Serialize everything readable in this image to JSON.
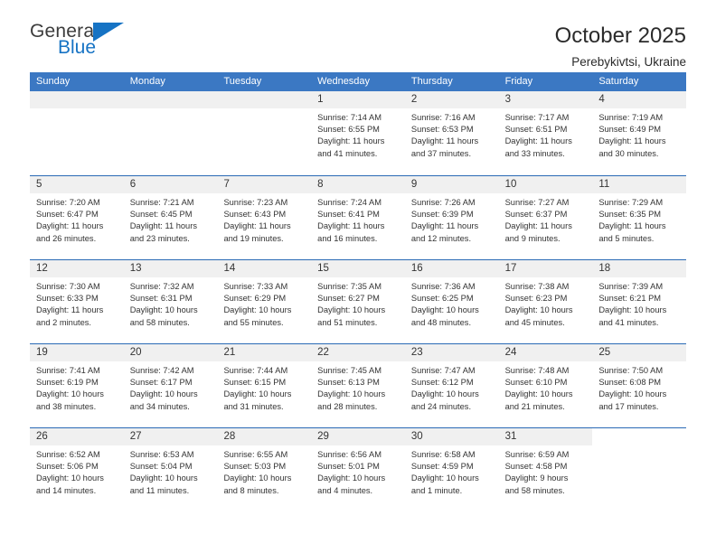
{
  "brand": {
    "name_top": "General",
    "name_bottom": "Blue",
    "accent_color": "#1673c4"
  },
  "header": {
    "title": "October 2025",
    "subtitle": "Perebykivtsi, Ukraine"
  },
  "theme": {
    "header_row_bg": "#3b78c3",
    "week_divider": "#2a6ab5",
    "day_number_bg": "#f0f0f0"
  },
  "calendar": {
    "day_names": [
      "Sunday",
      "Monday",
      "Tuesday",
      "Wednesday",
      "Thursday",
      "Friday",
      "Saturday"
    ],
    "weeks": [
      [
        {
          "day": "",
          "blank": true
        },
        {
          "day": "",
          "blank": true
        },
        {
          "day": "",
          "blank": true
        },
        {
          "day": "1",
          "sunrise": "Sunrise: 7:14 AM",
          "sunset": "Sunset: 6:55 PM",
          "daylight_line1": "Daylight: 11 hours",
          "daylight_line2": "and 41 minutes."
        },
        {
          "day": "2",
          "sunrise": "Sunrise: 7:16 AM",
          "sunset": "Sunset: 6:53 PM",
          "daylight_line1": "Daylight: 11 hours",
          "daylight_line2": "and 37 minutes."
        },
        {
          "day": "3",
          "sunrise": "Sunrise: 7:17 AM",
          "sunset": "Sunset: 6:51 PM",
          "daylight_line1": "Daylight: 11 hours",
          "daylight_line2": "and 33 minutes."
        },
        {
          "day": "4",
          "sunrise": "Sunrise: 7:19 AM",
          "sunset": "Sunset: 6:49 PM",
          "daylight_line1": "Daylight: 11 hours",
          "daylight_line2": "and 30 minutes."
        }
      ],
      [
        {
          "day": "5",
          "sunrise": "Sunrise: 7:20 AM",
          "sunset": "Sunset: 6:47 PM",
          "daylight_line1": "Daylight: 11 hours",
          "daylight_line2": "and 26 minutes."
        },
        {
          "day": "6",
          "sunrise": "Sunrise: 7:21 AM",
          "sunset": "Sunset: 6:45 PM",
          "daylight_line1": "Daylight: 11 hours",
          "daylight_line2": "and 23 minutes."
        },
        {
          "day": "7",
          "sunrise": "Sunrise: 7:23 AM",
          "sunset": "Sunset: 6:43 PM",
          "daylight_line1": "Daylight: 11 hours",
          "daylight_line2": "and 19 minutes."
        },
        {
          "day": "8",
          "sunrise": "Sunrise: 7:24 AM",
          "sunset": "Sunset: 6:41 PM",
          "daylight_line1": "Daylight: 11 hours",
          "daylight_line2": "and 16 minutes."
        },
        {
          "day": "9",
          "sunrise": "Sunrise: 7:26 AM",
          "sunset": "Sunset: 6:39 PM",
          "daylight_line1": "Daylight: 11 hours",
          "daylight_line2": "and 12 minutes."
        },
        {
          "day": "10",
          "sunrise": "Sunrise: 7:27 AM",
          "sunset": "Sunset: 6:37 PM",
          "daylight_line1": "Daylight: 11 hours",
          "daylight_line2": "and 9 minutes."
        },
        {
          "day": "11",
          "sunrise": "Sunrise: 7:29 AM",
          "sunset": "Sunset: 6:35 PM",
          "daylight_line1": "Daylight: 11 hours",
          "daylight_line2": "and 5 minutes."
        }
      ],
      [
        {
          "day": "12",
          "sunrise": "Sunrise: 7:30 AM",
          "sunset": "Sunset: 6:33 PM",
          "daylight_line1": "Daylight: 11 hours",
          "daylight_line2": "and 2 minutes."
        },
        {
          "day": "13",
          "sunrise": "Sunrise: 7:32 AM",
          "sunset": "Sunset: 6:31 PM",
          "daylight_line1": "Daylight: 10 hours",
          "daylight_line2": "and 58 minutes."
        },
        {
          "day": "14",
          "sunrise": "Sunrise: 7:33 AM",
          "sunset": "Sunset: 6:29 PM",
          "daylight_line1": "Daylight: 10 hours",
          "daylight_line2": "and 55 minutes."
        },
        {
          "day": "15",
          "sunrise": "Sunrise: 7:35 AM",
          "sunset": "Sunset: 6:27 PM",
          "daylight_line1": "Daylight: 10 hours",
          "daylight_line2": "and 51 minutes."
        },
        {
          "day": "16",
          "sunrise": "Sunrise: 7:36 AM",
          "sunset": "Sunset: 6:25 PM",
          "daylight_line1": "Daylight: 10 hours",
          "daylight_line2": "and 48 minutes."
        },
        {
          "day": "17",
          "sunrise": "Sunrise: 7:38 AM",
          "sunset": "Sunset: 6:23 PM",
          "daylight_line1": "Daylight: 10 hours",
          "daylight_line2": "and 45 minutes."
        },
        {
          "day": "18",
          "sunrise": "Sunrise: 7:39 AM",
          "sunset": "Sunset: 6:21 PM",
          "daylight_line1": "Daylight: 10 hours",
          "daylight_line2": "and 41 minutes."
        }
      ],
      [
        {
          "day": "19",
          "sunrise": "Sunrise: 7:41 AM",
          "sunset": "Sunset: 6:19 PM",
          "daylight_line1": "Daylight: 10 hours",
          "daylight_line2": "and 38 minutes."
        },
        {
          "day": "20",
          "sunrise": "Sunrise: 7:42 AM",
          "sunset": "Sunset: 6:17 PM",
          "daylight_line1": "Daylight: 10 hours",
          "daylight_line2": "and 34 minutes."
        },
        {
          "day": "21",
          "sunrise": "Sunrise: 7:44 AM",
          "sunset": "Sunset: 6:15 PM",
          "daylight_line1": "Daylight: 10 hours",
          "daylight_line2": "and 31 minutes."
        },
        {
          "day": "22",
          "sunrise": "Sunrise: 7:45 AM",
          "sunset": "Sunset: 6:13 PM",
          "daylight_line1": "Daylight: 10 hours",
          "daylight_line2": "and 28 minutes."
        },
        {
          "day": "23",
          "sunrise": "Sunrise: 7:47 AM",
          "sunset": "Sunset: 6:12 PM",
          "daylight_line1": "Daylight: 10 hours",
          "daylight_line2": "and 24 minutes."
        },
        {
          "day": "24",
          "sunrise": "Sunrise: 7:48 AM",
          "sunset": "Sunset: 6:10 PM",
          "daylight_line1": "Daylight: 10 hours",
          "daylight_line2": "and 21 minutes."
        },
        {
          "day": "25",
          "sunrise": "Sunrise: 7:50 AM",
          "sunset": "Sunset: 6:08 PM",
          "daylight_line1": "Daylight: 10 hours",
          "daylight_line2": "and 17 minutes."
        }
      ],
      [
        {
          "day": "26",
          "sunrise": "Sunrise: 6:52 AM",
          "sunset": "Sunset: 5:06 PM",
          "daylight_line1": "Daylight: 10 hours",
          "daylight_line2": "and 14 minutes."
        },
        {
          "day": "27",
          "sunrise": "Sunrise: 6:53 AM",
          "sunset": "Sunset: 5:04 PM",
          "daylight_line1": "Daylight: 10 hours",
          "daylight_line2": "and 11 minutes."
        },
        {
          "day": "28",
          "sunrise": "Sunrise: 6:55 AM",
          "sunset": "Sunset: 5:03 PM",
          "daylight_line1": "Daylight: 10 hours",
          "daylight_line2": "and 8 minutes."
        },
        {
          "day": "29",
          "sunrise": "Sunrise: 6:56 AM",
          "sunset": "Sunset: 5:01 PM",
          "daylight_line1": "Daylight: 10 hours",
          "daylight_line2": "and 4 minutes."
        },
        {
          "day": "30",
          "sunrise": "Sunrise: 6:58 AM",
          "sunset": "Sunset: 4:59 PM",
          "daylight_line1": "Daylight: 10 hours",
          "daylight_line2": "and 1 minute."
        },
        {
          "day": "31",
          "sunrise": "Sunrise: 6:59 AM",
          "sunset": "Sunset: 4:58 PM",
          "daylight_line1": "Daylight: 9 hours",
          "daylight_line2": "and 58 minutes."
        },
        {
          "day": "",
          "blank": true
        }
      ]
    ]
  }
}
